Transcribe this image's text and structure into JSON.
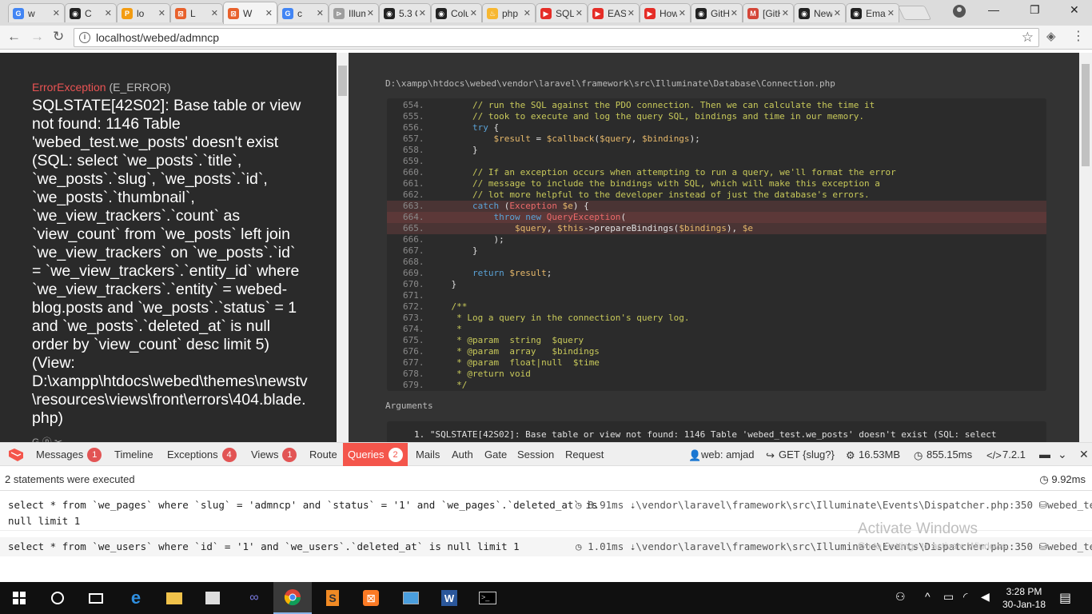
{
  "browser": {
    "tabs": [
      {
        "title": "w",
        "favicon_color": "#4285f4",
        "favicon": "G"
      },
      {
        "title": "C",
        "favicon_color": "#222222",
        "favicon": "◉"
      },
      {
        "title": "lo",
        "favicon_color": "#f39c12",
        "favicon": "P"
      },
      {
        "title": "L",
        "favicon_color": "#e8612c",
        "favicon": "⊠"
      },
      {
        "title": "W",
        "favicon_color": "#e8612c",
        "favicon": "⊠"
      },
      {
        "title": "c",
        "favicon_color": "#4285f4",
        "favicon": "G"
      },
      {
        "title": "Illum",
        "favicon_color": "#9e9e9e",
        "favicon": "⊳"
      },
      {
        "title": "5.3 C",
        "favicon_color": "#222222",
        "favicon": "◉"
      },
      {
        "title": "Colu",
        "favicon_color": "#222222",
        "favicon": "◉"
      },
      {
        "title": "php",
        "favicon_color": "#f7b731",
        "favicon": "♨"
      },
      {
        "title": "SQLS",
        "favicon_color": "#e52d27",
        "favicon": "▶"
      },
      {
        "title": "EASY",
        "favicon_color": "#e52d27",
        "favicon": "▶"
      },
      {
        "title": "How",
        "favicon_color": "#e52d27",
        "favicon": "▶"
      },
      {
        "title": "GitH",
        "favicon_color": "#222222",
        "favicon": "◉"
      },
      {
        "title": "[GitH",
        "favicon_color": "#d44638",
        "favicon": "M"
      },
      {
        "title": "New",
        "favicon_color": "#222222",
        "favicon": "◉"
      },
      {
        "title": "Emai",
        "favicon_color": "#222222",
        "favicon": "◉"
      }
    ],
    "url": "localhost/webed/admncp",
    "window_controls": {
      "minimize": "—",
      "maximize": "❐",
      "close": "✕"
    }
  },
  "error": {
    "type": "ErrorException",
    "level": "(E_ERROR)",
    "message": "SQLSTATE[42S02]: Base table or view not found: 1146 Table 'webed_test.we_posts' doesn't exist (SQL: select `we_posts`.`title`, `we_posts`.`slug`, `we_posts`.`id`, `we_posts`.`thumbnail`, `we_view_trackers`.`count` as `view_count` from `we_posts` left join `we_view_trackers` on `we_posts`.`id` = `we_view_trackers`.`entity_id` where `we_view_trackers`.`entity` = webed-blog.posts and `we_posts`.`status` = 1 and `we_posts`.`deleted_at` is null order by `view_count` desc limit 5) (View: D:\\xampp\\htdocs\\webed\\themes\\newstv\\resources\\views\\front\\errors\\404.blade.php)",
    "footer_icons": "G ⓟ ✂"
  },
  "code": {
    "file_path": "D:\\xampp\\htdocs\\webed\\vendor\\laravel\\framework\\src\\Illuminate\\Database\\Connection.php",
    "lines": [
      {
        "n": "654.",
        "parts": [
          [
            "pl",
            "        "
          ],
          [
            "cm",
            "// run the SQL against the PDO connection. Then we can calculate the time it"
          ]
        ]
      },
      {
        "n": "655.",
        "parts": [
          [
            "pl",
            "        "
          ],
          [
            "cm",
            "// took to execute and log the query SQL, bindings and time in our memory."
          ]
        ]
      },
      {
        "n": "656.",
        "parts": [
          [
            "pl",
            "        "
          ],
          [
            "kw",
            "try"
          ],
          [
            "pl",
            " {"
          ]
        ]
      },
      {
        "n": "657.",
        "parts": [
          [
            "pl",
            "            "
          ],
          [
            "vr",
            "$result"
          ],
          [
            "pl",
            " = "
          ],
          [
            "vr",
            "$callback"
          ],
          [
            "pl",
            "("
          ],
          [
            "vr",
            "$query"
          ],
          [
            "pl",
            ", "
          ],
          [
            "vr",
            "$bindings"
          ],
          [
            "pl",
            ");"
          ]
        ]
      },
      {
        "n": "658.",
        "parts": [
          [
            "pl",
            "        }"
          ]
        ]
      },
      {
        "n": "659.",
        "parts": [
          [
            "pl",
            ""
          ]
        ]
      },
      {
        "n": "660.",
        "parts": [
          [
            "pl",
            "        "
          ],
          [
            "cm",
            "// If an exception occurs when attempting to run a query, we'll format the error"
          ]
        ]
      },
      {
        "n": "661.",
        "parts": [
          [
            "pl",
            "        "
          ],
          [
            "cm",
            "// message to include the bindings with SQL, which will make this exception a"
          ]
        ]
      },
      {
        "n": "662.",
        "parts": [
          [
            "pl",
            "        "
          ],
          [
            "cm",
            "// lot more helpful to the developer instead of just the database's errors."
          ]
        ]
      },
      {
        "n": "663.",
        "hl": "hl",
        "parts": [
          [
            "pl",
            "        "
          ],
          [
            "kw",
            "catch"
          ],
          [
            "pl",
            " ("
          ],
          [
            "ex",
            "Exception"
          ],
          [
            "pl",
            " "
          ],
          [
            "vr",
            "$e"
          ],
          [
            "pl",
            ") {"
          ]
        ]
      },
      {
        "n": "664.",
        "hl": "hl2",
        "parts": [
          [
            "pl",
            "            "
          ],
          [
            "kw",
            "throw new"
          ],
          [
            "pl",
            " "
          ],
          [
            "ex",
            "QueryException"
          ],
          [
            "pl",
            "("
          ]
        ]
      },
      {
        "n": "665.",
        "hl": "hl",
        "parts": [
          [
            "pl",
            "                "
          ],
          [
            "vr",
            "$query"
          ],
          [
            "pl",
            ", "
          ],
          [
            "vr",
            "$this"
          ],
          [
            "pl",
            "->prepareBindings("
          ],
          [
            "vr",
            "$bindings"
          ],
          [
            "pl",
            "), "
          ],
          [
            "vr",
            "$e"
          ]
        ]
      },
      {
        "n": "666.",
        "parts": [
          [
            "pl",
            "            );"
          ]
        ]
      },
      {
        "n": "667.",
        "parts": [
          [
            "pl",
            "        }"
          ]
        ]
      },
      {
        "n": "668.",
        "parts": [
          [
            "pl",
            ""
          ]
        ]
      },
      {
        "n": "669.",
        "parts": [
          [
            "pl",
            "        "
          ],
          [
            "kw",
            "return"
          ],
          [
            "pl",
            " "
          ],
          [
            "vr",
            "$result"
          ],
          [
            "pl",
            ";"
          ]
        ]
      },
      {
        "n": "670.",
        "parts": [
          [
            "pl",
            "    }"
          ]
        ]
      },
      {
        "n": "671.",
        "parts": [
          [
            "pl",
            ""
          ]
        ]
      },
      {
        "n": "672.",
        "parts": [
          [
            "pl",
            "    "
          ],
          [
            "cm",
            "/**"
          ]
        ]
      },
      {
        "n": "673.",
        "parts": [
          [
            "pl",
            "     "
          ],
          [
            "cm",
            "* Log a query in the connection's query log."
          ]
        ]
      },
      {
        "n": "674.",
        "parts": [
          [
            "pl",
            "     "
          ],
          [
            "cm",
            "*"
          ]
        ]
      },
      {
        "n": "675.",
        "parts": [
          [
            "pl",
            "     "
          ],
          [
            "cm",
            "* @param  string  $query"
          ]
        ]
      },
      {
        "n": "676.",
        "parts": [
          [
            "pl",
            "     "
          ],
          [
            "cm",
            "* @param  array   $bindings"
          ]
        ]
      },
      {
        "n": "677.",
        "parts": [
          [
            "pl",
            "     "
          ],
          [
            "cm",
            "* @param  float|null  $time"
          ]
        ]
      },
      {
        "n": "678.",
        "parts": [
          [
            "pl",
            "     "
          ],
          [
            "cm",
            "* @return void"
          ]
        ]
      },
      {
        "n": "679.",
        "parts": [
          [
            "pl",
            "     "
          ],
          [
            "cm",
            "*/"
          ]
        ]
      }
    ],
    "arguments_label": "Arguments",
    "argument_1": "1. \"SQLSTATE[42S02]: Base table or view not found: 1146 Table 'webed_test.we_posts' doesn't exist (SQL: select"
  },
  "debugbar": {
    "tabs": [
      {
        "label": "Messages",
        "badge": "1"
      },
      {
        "label": "Timeline",
        "badge": ""
      },
      {
        "label": "Exceptions",
        "badge": "4"
      },
      {
        "label": "Views",
        "badge": "1"
      },
      {
        "label": "Route",
        "badge": ""
      },
      {
        "label": "Queries",
        "badge": "2"
      },
      {
        "label": "Mails",
        "badge": ""
      },
      {
        "label": "Auth",
        "badge": ""
      },
      {
        "label": "Gate",
        "badge": ""
      },
      {
        "label": "Session",
        "badge": ""
      },
      {
        "label": "Request",
        "badge": ""
      }
    ],
    "auth_user": "web: amjad",
    "route": "GET {slug?}",
    "memory": "16.53MB",
    "duration": "855.15ms",
    "php_version": "7.2.1"
  },
  "queries": {
    "summary": "2 statements were executed",
    "total_time": "9.92ms",
    "items": [
      {
        "sql_line1": "select * from `we_pages` where `slug` = 'admncp' and `status` = '1' and `we_pages`.`deleted_at` is",
        "sql_line2": "null limit 1",
        "time": "8.91ms",
        "source": "\\vendor\\laravel\\framework\\src\\Illuminate\\Events\\Dispatcher.php:350",
        "connection": "webed_test"
      },
      {
        "sql_line1": "select * from `we_users` where `id` = '1' and `we_users`.`deleted_at` is null limit 1",
        "sql_line2": "",
        "time": "1.01ms",
        "source": "\\vendor\\laravel\\framework\\src\\Illuminate\\Events\\Dispatcher.php:350",
        "connection": "webed_test"
      }
    ]
  },
  "watermark": {
    "title": "Activate Windows",
    "subtitle": "Go to Settings to activate Windows."
  },
  "taskbar": {
    "time": "3:28 PM",
    "date": "30-Jan-18"
  },
  "colors": {
    "error_red": "#e95353",
    "whoops_left_bg": "#2a2a2a",
    "whoops_right_bg": "#333333",
    "debugbar_accent": "#f4554b",
    "taskbar_bg": "#101010"
  }
}
